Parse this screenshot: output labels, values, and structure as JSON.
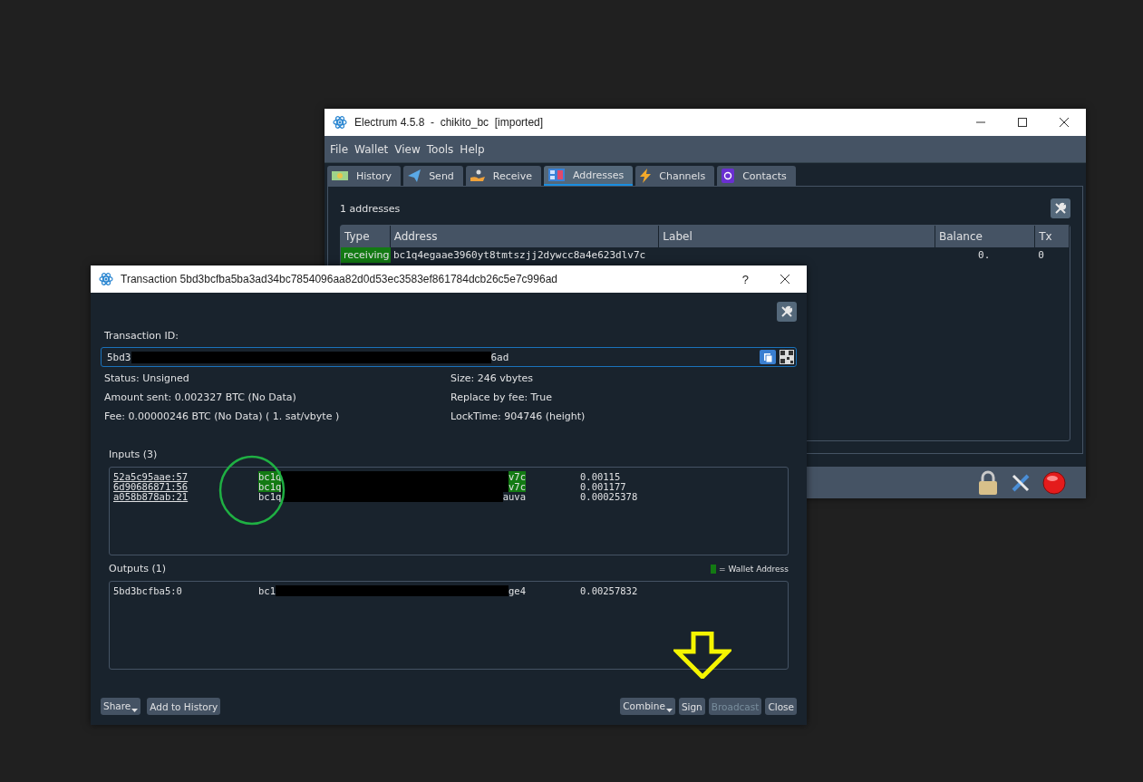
{
  "main_window": {
    "title": "Electrum 4.5.8  -  chikito_bc  [imported]",
    "menu": [
      "File",
      "Wallet",
      "View",
      "Tools",
      "Help"
    ],
    "tabs": [
      {
        "label": "History",
        "kind": "history",
        "selected": false
      },
      {
        "label": "Send",
        "kind": "send",
        "selected": false
      },
      {
        "label": "Receive",
        "kind": "receive",
        "selected": false
      },
      {
        "label": "Addresses",
        "kind": "addresses",
        "selected": true
      },
      {
        "label": "Channels",
        "kind": "channels",
        "selected": false
      },
      {
        "label": "Contacts",
        "kind": "contacts",
        "selected": false
      }
    ],
    "address_count": "1 addresses",
    "table": {
      "columns": [
        "Type",
        "Address",
        "Label",
        "Balance",
        "Tx"
      ],
      "rows": [
        {
          "type": "receiving",
          "address": "bc1q4egaae3960yt8tmtszjj2dywcc8a4e623dlv7c",
          "balance": "0.",
          "tx": "0"
        }
      ]
    }
  },
  "transaction_dialog": {
    "title": "Transaction 5bd3bcfba5ba3ad34bc7854096aa82d0d53ec3583ef861784dcb26c5e7c996ad",
    "help_button": "?",
    "txid_label": "Transaction ID:",
    "txid": {
      "start": "5bd3",
      "end": "6ad"
    },
    "info_left": [
      "Status: Unsigned",
      "Amount sent: 0.002327 BTC (No Data)",
      "Fee: 0.00000246 BTC (No Data)  ( 1. sat/vbyte )"
    ],
    "info_right": [
      "Size: 246 vbytes",
      "Replace by fee: True",
      "LockTime: 904746 (height)"
    ],
    "inputs": {
      "title": "Inputs (3)",
      "rows": [
        {
          "outpoint": "52a5c95aae:57",
          "address_start": "bc1q",
          "address_end": "v7c",
          "amount": "0.00115",
          "wallet": true
        },
        {
          "outpoint": "6d90686871:56",
          "address_start": "bc1q",
          "address_end": "v7c",
          "amount": "0.001177",
          "wallet": true
        },
        {
          "outpoint": "a058b878ab:21",
          "address_start": "bc1q",
          "address_end": "auva",
          "amount": "0.00025378",
          "wallet": false
        }
      ]
    },
    "outputs": {
      "title": "Outputs (1)",
      "legend": "= Wallet Address",
      "rows": [
        {
          "outpoint": "5bd3bcfba5:0",
          "address_start": "bc1",
          "address_end": "ge4",
          "amount": "0.00257832",
          "wallet": false
        }
      ]
    },
    "buttons_left": [
      {
        "label": "Share",
        "kind": "menu",
        "disabled": false
      },
      {
        "label": "Add to History",
        "kind": "plain",
        "disabled": false
      }
    ],
    "buttons_right": [
      {
        "label": "Combine",
        "kind": "menu",
        "disabled": false
      },
      {
        "label": "Sign",
        "kind": "plain",
        "disabled": false
      },
      {
        "label": "Broadcast",
        "kind": "plain",
        "disabled": true
      },
      {
        "label": "Close",
        "kind": "plain",
        "disabled": false
      }
    ]
  }
}
